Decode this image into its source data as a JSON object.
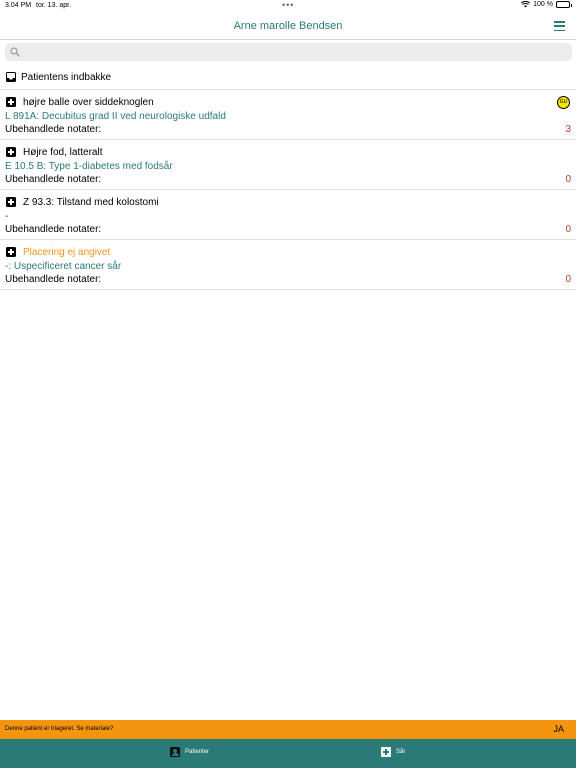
{
  "status_bar": {
    "time": "3.04 PM",
    "date": "tor. 13. apr.",
    "dots": "•••",
    "battery_text": "100 %"
  },
  "header": {
    "title": "Arne marolle Bendsen",
    "menu_icon": "hamburger-menu-icon"
  },
  "search": {
    "placeholder": "",
    "icon": "search-icon"
  },
  "inbox": {
    "label": "Patientens indbakke",
    "icon": "inbox-icon"
  },
  "wounds": [
    {
      "location": "højre balle over siddeknoglen",
      "diagnosis": "L 891A: Decubitus grad II ved neurologiske udfald",
      "notes_label": "Ubehandlede notater:",
      "notes_count": "3",
      "badge": "GU"
    },
    {
      "location": "Højre fod, latteralt",
      "diagnosis": "E 10.5 B: Type 1-diabetes med fodsår",
      "notes_label": "Ubehandlede notater:",
      "notes_count": "0"
    },
    {
      "location": "Z 93.3: Tilstand med kolostomi",
      "diagnosis": "-",
      "notes_label": "Ubehandlede notater:",
      "notes_count": "0"
    },
    {
      "location": "Placering ej angivet",
      "diagnosis": "-: Uspecificeret cancer sår",
      "notes_label": "Ubehandlede notater:",
      "notes_count": "0"
    }
  ],
  "triage_banner": {
    "message": "Denne patient er triageret. Se materiale?",
    "action": "JA"
  },
  "tabs": [
    {
      "label": "Patienter",
      "icon": "patient-icon"
    },
    {
      "label": "Sår",
      "icon": "wound-plus-icon"
    }
  ],
  "colors": {
    "accent": "#2a7a78",
    "warning": "#f5950f",
    "count": "#c0392b",
    "unset_location": "#f0961e",
    "badge": "#f5e400"
  }
}
